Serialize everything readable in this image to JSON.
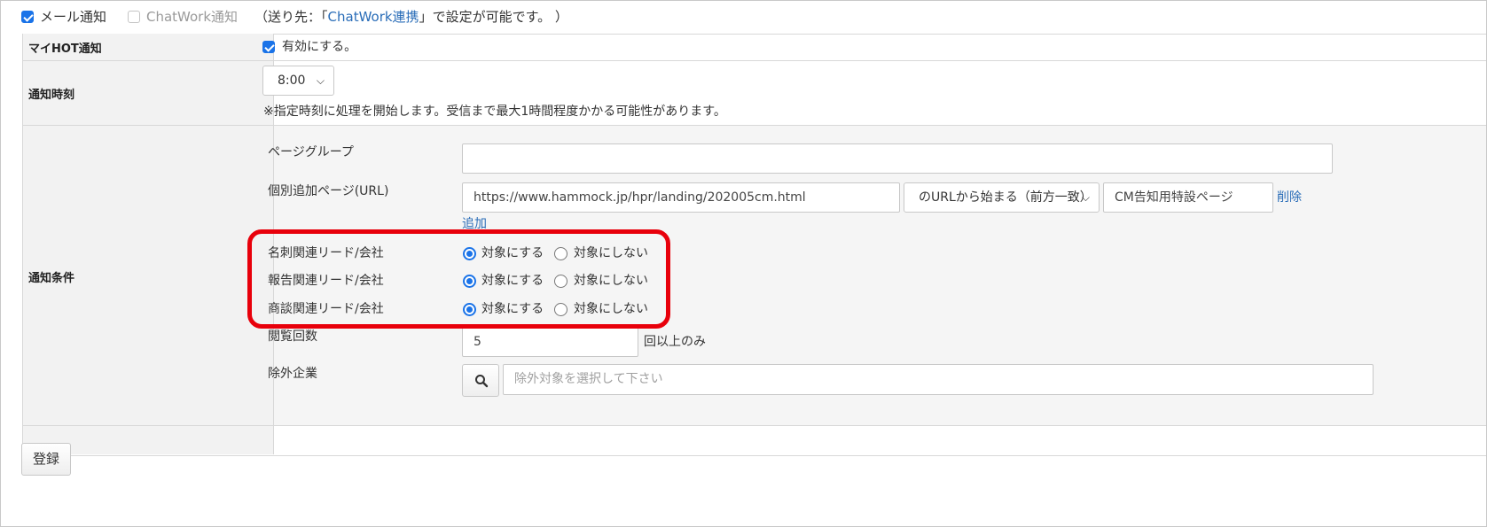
{
  "top": {
    "mail_label": "メール通知",
    "chatwork_label": "ChatWork通知",
    "note_prefix": "（送り先：「",
    "note_link": "ChatWork連携",
    "note_suffix": "」で設定が可能です。 ）"
  },
  "myhot": {
    "label": "マイHOT通知",
    "enable_label": "有効にする。"
  },
  "time": {
    "label": "通知時刻",
    "selected": "8:00",
    "note": "※指定時刻に処理を開始します。受信まで最大1時間程度かかる可能性があります。"
  },
  "conditions": {
    "label": "通知条件",
    "page_group_label": "ページグループ",
    "page_group_value": "",
    "url_label": "個別追加ページ(URL)",
    "url_value": "https://www.hammock.jp/hpr/landing/202005cm.html",
    "match_select": "のURLから始まる（前方一致）",
    "page_name_value": "CM告知用特設ページ",
    "delete_link": "削除",
    "add_link": "追加",
    "options": [
      {
        "label": "名刺関連リード/会社",
        "on_label": "対象にする",
        "off_label": "対象にしない",
        "selected": "on"
      },
      {
        "label": "報告関連リード/会社",
        "on_label": "対象にする",
        "off_label": "対象にしない",
        "selected": "on"
      },
      {
        "label": "商談関連リード/会社",
        "on_label": "対象にする",
        "off_label": "対象にしない",
        "selected": "on"
      }
    ],
    "views_label": "閲覧回数",
    "views_value": "5",
    "views_suffix": "回以上のみ",
    "exclude_label": "除外企業",
    "exclude_placeholder": "除外対象を選択して下さい"
  },
  "submit_label": "登録",
  "icons": {
    "search": "search-icon",
    "caret": "chevron-down-icon"
  },
  "colors": {
    "accent": "#1a73e8",
    "link": "#2a6db8",
    "highlight": "#e8000b"
  }
}
